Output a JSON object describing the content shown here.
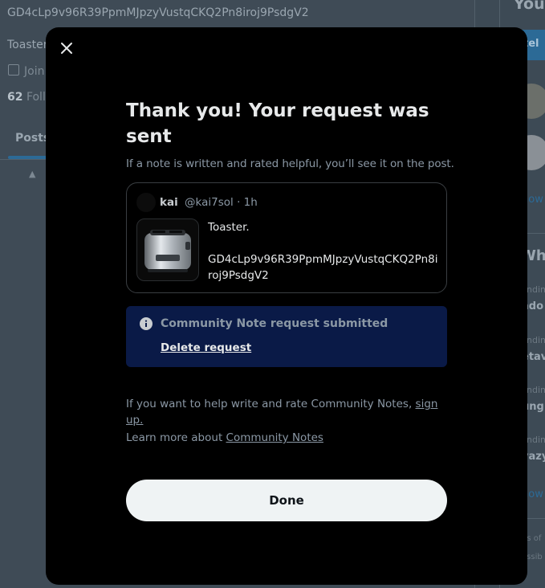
{
  "background": {
    "profile_handle": "GD4cLp9v96R39PpmMJpzyVustqCKQ2Pn8iroj9PsdgV2",
    "profile_name": "Toaster",
    "joined_label": "Join",
    "followers_count": "62",
    "followers_label": "Follo",
    "tab_posts": "Posts",
    "right_title": "You",
    "right_button": "tel",
    "show_more_1": "how",
    "right_heading": "Wha",
    "trends": [
      {
        "small": "ndin",
        "big": "ado"
      },
      {
        "small": "ndin",
        "big": "etav"
      },
      {
        "small": "ndin",
        "big": "ung"
      },
      {
        "small": "ndin",
        "big": "vazy"
      }
    ],
    "show_more_2": "how",
    "footer_1": "ns of",
    "footer_2": "essib"
  },
  "modal": {
    "title": "Thank you! Your request was sent",
    "subtitle": "If a note is written and rated helpful, you’ll see it on the post.",
    "post": {
      "author": "kai",
      "handle": "@kai7sol",
      "separator": "·",
      "time": "1h",
      "text_line1": "Toaster.",
      "text_line2": "GD4cLp9v96R39PpmMJpzyVustqCKQ2Pn8iroj9PsdgV2"
    },
    "notice": {
      "title": "Community Note request submitted",
      "delete_label": "Delete request"
    },
    "help": {
      "prefix": "If you want to help write and rate Community Notes, ",
      "link": "sign up."
    },
    "learn": {
      "prefix": "Learn more about ",
      "link": "Community Notes"
    },
    "done_label": "Done"
  },
  "colors": {
    "modal_bg": "#000000",
    "notice_bg": "#0a1a47",
    "button_bg": "#eff3f4",
    "accent": "#1d9bf0"
  },
  "icons": [
    "close-icon",
    "info-icon",
    "calendar-icon",
    "pin-icon"
  ]
}
